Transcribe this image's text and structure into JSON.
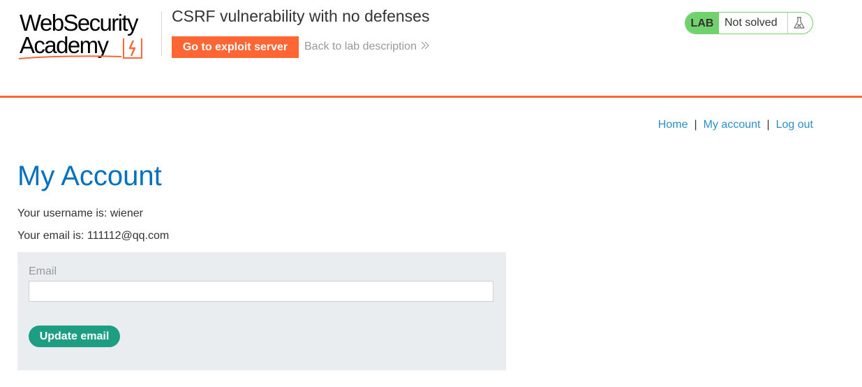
{
  "header": {
    "logo_line1": "WebSecurity",
    "logo_line2": "Academy",
    "lab_title": "CSRF vulnerability with no defenses",
    "exploit_button": "Go to exploit server",
    "back_link": "Back to lab description",
    "back_link_icon": "double-chevron-right-icon",
    "status": {
      "badge": "LAB",
      "text": "Not solved",
      "icon": "flask-icon"
    }
  },
  "nav": {
    "home": "Home",
    "sep": "|",
    "my_account": "My account",
    "log_out": "Log out"
  },
  "main": {
    "title": "My Account",
    "username_line": "Your username is: wiener",
    "email_line": "Your email is: 111112@qq.com",
    "form": {
      "email_label": "Email",
      "email_value": "",
      "submit_label": "Update email"
    }
  },
  "colors": {
    "accent_orange": "#ff6633",
    "title_blue": "#0071bc",
    "link_blue": "#2a90c9",
    "lab_green": "#70d16d",
    "button_teal": "#1d9e83",
    "panel_bg": "#e9edf0"
  }
}
